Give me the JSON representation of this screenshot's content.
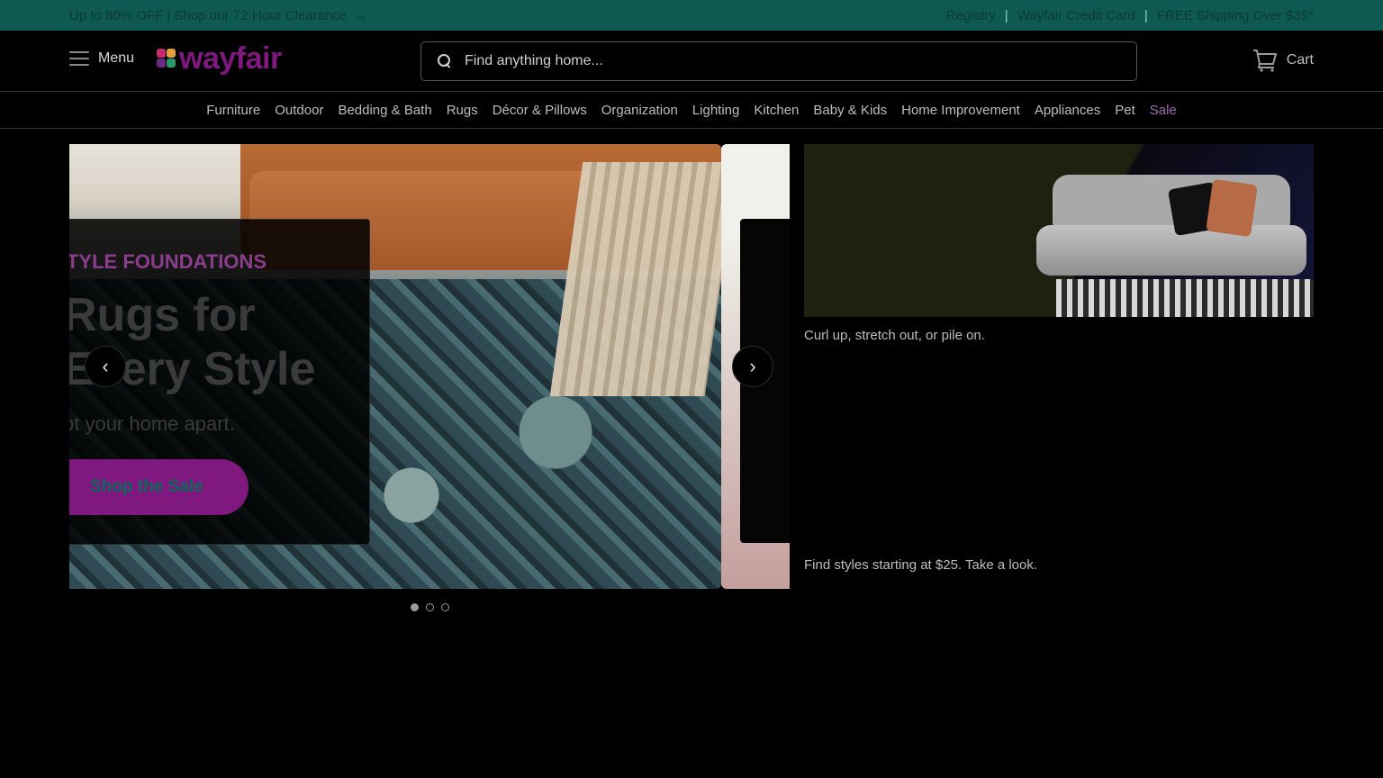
{
  "topbar": {
    "promo": "Up to 80% OFF | Shop our 72-Hour Clearance",
    "links": [
      "Registry",
      "Wayfair Credit Card",
      "FREE Shipping Over $35*"
    ],
    "separator": "|",
    "background": "#0e5a52"
  },
  "header": {
    "menu_label": "Menu",
    "logo_text": "wayfair",
    "brand_color": "#7f187f",
    "search_placeholder": "Find anything home...",
    "cart_label": "Cart"
  },
  "nav": {
    "items": [
      "Furniture",
      "Outdoor",
      "Bedding & Bath",
      "Rugs",
      "Décor & Pillows",
      "Organization",
      "Lighting",
      "Kitchen",
      "Baby & Kids",
      "Home Improvement",
      "Appliances",
      "Pet"
    ],
    "sale": "Sale"
  },
  "hero": {
    "eyebrow": "TYLE FOUNDATIONS",
    "headline": "Rugs for\nEvery Style",
    "subline": "ot your home apart.",
    "cta": "Shop the Sale",
    "prev_icon": "chevron-left-icon",
    "next_icon": "chevron-right-icon",
    "prev_glyph": "‹",
    "next_glyph": "›",
    "slide_count": 3,
    "active_slide": 1
  },
  "side": {
    "caption1": "Curl up, stretch out, or pile on.",
    "caption2": "Find styles starting at $25. Take a look."
  }
}
